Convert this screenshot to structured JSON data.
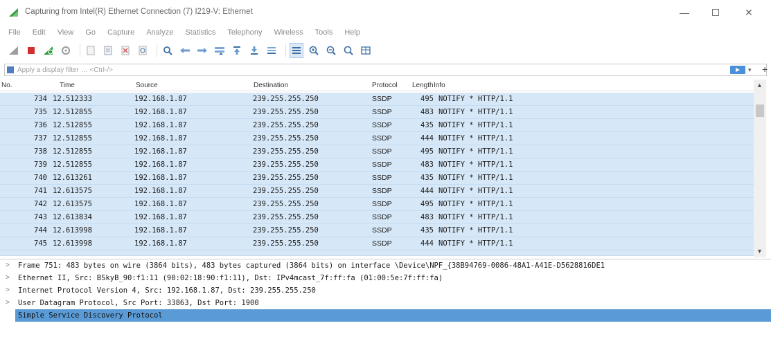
{
  "window": {
    "title": "Capturing from Intel(R) Ethernet Connection (7) I219-V: Ethernet",
    "minimize": "—",
    "close": "✕"
  },
  "menu": [
    "File",
    "Edit",
    "View",
    "Go",
    "Capture",
    "Analyze",
    "Statistics",
    "Telephony",
    "Wireless",
    "Tools",
    "Help"
  ],
  "toolbar_icons": [
    "shark-fin-start-icon",
    "stop-icon",
    "restart-icon",
    "options-icon",
    "open-file-icon",
    "close-file-icon",
    "reload-icon",
    "find-packet-icon",
    "go-back-icon",
    "go-forward-icon",
    "go-to-packet-icon",
    "first-packet-icon",
    "last-packet-icon",
    "autoscroll-icon",
    "colorize-icon",
    "zoom-in-icon",
    "zoom-out-icon",
    "normal-size-icon",
    "resize-columns-icon"
  ],
  "filter": {
    "placeholder": "Apply a display filter … <Ctrl-/>",
    "plus": "+"
  },
  "columns": {
    "no": "No.",
    "time": "Time",
    "source": "Source",
    "destination": "Destination",
    "protocol": "Protocol",
    "length": "Length",
    "info": "Info"
  },
  "packets": [
    {
      "no": "734",
      "time": "12.512333",
      "source": "192.168.1.87",
      "destination": "239.255.255.250",
      "protocol": "SSDP",
      "length": "495",
      "info": "NOTIFY * HTTP/1.1"
    },
    {
      "no": "735",
      "time": "12.512855",
      "source": "192.168.1.87",
      "destination": "239.255.255.250",
      "protocol": "SSDP",
      "length": "483",
      "info": "NOTIFY * HTTP/1.1"
    },
    {
      "no": "736",
      "time": "12.512855",
      "source": "192.168.1.87",
      "destination": "239.255.255.250",
      "protocol": "SSDP",
      "length": "435",
      "info": "NOTIFY * HTTP/1.1"
    },
    {
      "no": "737",
      "time": "12.512855",
      "source": "192.168.1.87",
      "destination": "239.255.255.250",
      "protocol": "SSDP",
      "length": "444",
      "info": "NOTIFY * HTTP/1.1"
    },
    {
      "no": "738",
      "time": "12.512855",
      "source": "192.168.1.87",
      "destination": "239.255.255.250",
      "protocol": "SSDP",
      "length": "495",
      "info": "NOTIFY * HTTP/1.1"
    },
    {
      "no": "739",
      "time": "12.512855",
      "source": "192.168.1.87",
      "destination": "239.255.255.250",
      "protocol": "SSDP",
      "length": "483",
      "info": "NOTIFY * HTTP/1.1"
    },
    {
      "no": "740",
      "time": "12.613261",
      "source": "192.168.1.87",
      "destination": "239.255.255.250",
      "protocol": "SSDP",
      "length": "435",
      "info": "NOTIFY * HTTP/1.1"
    },
    {
      "no": "741",
      "time": "12.613575",
      "source": "192.168.1.87",
      "destination": "239.255.255.250",
      "protocol": "SSDP",
      "length": "444",
      "info": "NOTIFY * HTTP/1.1"
    },
    {
      "no": "742",
      "time": "12.613575",
      "source": "192.168.1.87",
      "destination": "239.255.255.250",
      "protocol": "SSDP",
      "length": "495",
      "info": "NOTIFY * HTTP/1.1"
    },
    {
      "no": "743",
      "time": "12.613834",
      "source": "192.168.1.87",
      "destination": "239.255.255.250",
      "protocol": "SSDP",
      "length": "483",
      "info": "NOTIFY * HTTP/1.1"
    },
    {
      "no": "744",
      "time": "12.613998",
      "source": "192.168.1.87",
      "destination": "239.255.255.250",
      "protocol": "SSDP",
      "length": "435",
      "info": "NOTIFY * HTTP/1.1"
    },
    {
      "no": "745",
      "time": "12.613998",
      "source": "192.168.1.87",
      "destination": "239.255.255.250",
      "protocol": "SSDP",
      "length": "444",
      "info": "NOTIFY * HTTP/1.1"
    }
  ],
  "details": [
    {
      "text": "Frame 751: 483 bytes on wire (3864 bits), 483 bytes captured (3864 bits) on interface \\Device\\NPF_{38B94769-0086-48A1-A41E-D5628816DE1",
      "selected": false
    },
    {
      "text": "Ethernet II, Src: BSkyB_90:f1:11 (90:02:18:90:f1:11), Dst: IPv4mcast_7f:ff:fa (01:00:5e:7f:ff:fa)",
      "selected": false
    },
    {
      "text": "Internet Protocol Version 4, Src: 192.168.1.87, Dst: 239.255.255.250",
      "selected": false
    },
    {
      "text": "User Datagram Protocol, Src Port: 33863, Dst Port: 1900",
      "selected": false
    },
    {
      "text": "Simple Service Discovery Protocol",
      "selected": true
    }
  ],
  "colors": {
    "row_bg": "#d6e7f7",
    "selected_detail": "#5b9bd5",
    "stop_red": "#d32f2f",
    "fin_green": "#2e9d3c"
  }
}
